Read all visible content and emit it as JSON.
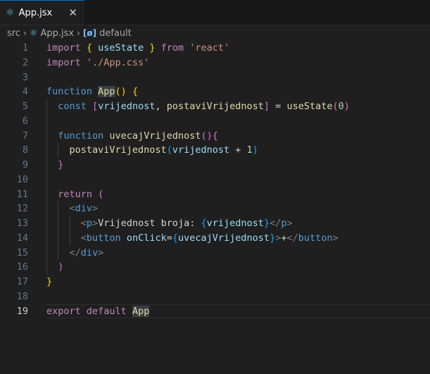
{
  "tab": {
    "label": "App.jsx",
    "close": "✕"
  },
  "breadcrumb": {
    "folder": "src",
    "file": "App.jsx",
    "symbol": "default"
  },
  "editor": {
    "current_line": 19,
    "lines": [
      {
        "n": "1",
        "indent": 0,
        "tokens": [
          {
            "t": "import ",
            "c": "tk-ctrl"
          },
          {
            "t": "{",
            "c": "tk-b1"
          },
          {
            "t": " useState ",
            "c": "tk-var"
          },
          {
            "t": "}",
            "c": "tk-b1"
          },
          {
            "t": " from ",
            "c": "tk-ctrl"
          },
          {
            "t": "'react'",
            "c": "tk-str"
          }
        ]
      },
      {
        "n": "2",
        "indent": 0,
        "tokens": [
          {
            "t": "import ",
            "c": "tk-ctrl"
          },
          {
            "t": "'./App.css'",
            "c": "tk-str"
          }
        ]
      },
      {
        "n": "3",
        "indent": 0,
        "tokens": []
      },
      {
        "n": "4",
        "indent": 0,
        "tokens": [
          {
            "t": "function ",
            "c": "tk-kw"
          },
          {
            "t": "App",
            "c": "tk-fn tk-hl"
          },
          {
            "t": "()",
            "c": "tk-b1"
          },
          {
            "t": " ",
            "c": "tk-plain"
          },
          {
            "t": "{",
            "c": "tk-b1"
          }
        ]
      },
      {
        "n": "5",
        "indent": 1,
        "tokens": [
          {
            "t": "const ",
            "c": "tk-kw"
          },
          {
            "t": "[",
            "c": "tk-b2"
          },
          {
            "t": "vrijednost",
            "c": "tk-var"
          },
          {
            "t": ", ",
            "c": "tk-plain"
          },
          {
            "t": "postaviVrijednost",
            "c": "tk-fn"
          },
          {
            "t": "]",
            "c": "tk-b2"
          },
          {
            "t": " = ",
            "c": "tk-plain"
          },
          {
            "t": "useState",
            "c": "tk-fn"
          },
          {
            "t": "(",
            "c": "tk-b2"
          },
          {
            "t": "0",
            "c": "tk-num"
          },
          {
            "t": ")",
            "c": "tk-b2"
          }
        ]
      },
      {
        "n": "6",
        "indent": 1,
        "tokens": []
      },
      {
        "n": "7",
        "indent": 1,
        "tokens": [
          {
            "t": "function ",
            "c": "tk-kw"
          },
          {
            "t": "uvecajVrijednost",
            "c": "tk-fn"
          },
          {
            "t": "()",
            "c": "tk-b2"
          },
          {
            "t": "{",
            "c": "tk-b2"
          }
        ]
      },
      {
        "n": "8",
        "indent": 2,
        "tokens": [
          {
            "t": "postaviVrijednost",
            "c": "tk-fn"
          },
          {
            "t": "(",
            "c": "tk-b3"
          },
          {
            "t": "vrijednost",
            "c": "tk-var"
          },
          {
            "t": " + ",
            "c": "tk-plain"
          },
          {
            "t": "1",
            "c": "tk-num"
          },
          {
            "t": ")",
            "c": "tk-b3"
          }
        ]
      },
      {
        "n": "9",
        "indent": 1,
        "tokens": [
          {
            "t": "}",
            "c": "tk-b2"
          }
        ]
      },
      {
        "n": "10",
        "indent": 1,
        "tokens": []
      },
      {
        "n": "11",
        "indent": 1,
        "tokens": [
          {
            "t": "return ",
            "c": "tk-ctrl"
          },
          {
            "t": "(",
            "c": "tk-b2"
          }
        ]
      },
      {
        "n": "12",
        "indent": 2,
        "tokens": [
          {
            "t": "<",
            "c": "tk-tagbr"
          },
          {
            "t": "div",
            "c": "tk-tag"
          },
          {
            "t": ">",
            "c": "tk-tagbr"
          }
        ]
      },
      {
        "n": "13",
        "indent": 3,
        "tokens": [
          {
            "t": "<",
            "c": "tk-tagbr"
          },
          {
            "t": "p",
            "c": "tk-tag"
          },
          {
            "t": ">",
            "c": "tk-tagbr"
          },
          {
            "t": "Vrijednost broja: ",
            "c": "tk-plain"
          },
          {
            "t": "{",
            "c": "tk-b3"
          },
          {
            "t": "vrijednost",
            "c": "tk-var"
          },
          {
            "t": "}",
            "c": "tk-b3"
          },
          {
            "t": "</",
            "c": "tk-tagbr"
          },
          {
            "t": "p",
            "c": "tk-tag"
          },
          {
            "t": ">",
            "c": "tk-tagbr"
          }
        ]
      },
      {
        "n": "14",
        "indent": 3,
        "tokens": [
          {
            "t": "<",
            "c": "tk-tagbr"
          },
          {
            "t": "button ",
            "c": "tk-tag"
          },
          {
            "t": "onClick",
            "c": "tk-attr"
          },
          {
            "t": "=",
            "c": "tk-plain"
          },
          {
            "t": "{",
            "c": "tk-b3"
          },
          {
            "t": "uvecajVrijednost",
            "c": "tk-var"
          },
          {
            "t": "}",
            "c": "tk-b3"
          },
          {
            "t": ">",
            "c": "tk-tagbr"
          },
          {
            "t": "+",
            "c": "tk-plain"
          },
          {
            "t": "</",
            "c": "tk-tagbr"
          },
          {
            "t": "button",
            "c": "tk-tag"
          },
          {
            "t": ">",
            "c": "tk-tagbr"
          }
        ]
      },
      {
        "n": "15",
        "indent": 2,
        "tokens": [
          {
            "t": "</",
            "c": "tk-tagbr"
          },
          {
            "t": "div",
            "c": "tk-tag"
          },
          {
            "t": ">",
            "c": "tk-tagbr"
          }
        ]
      },
      {
        "n": "16",
        "indent": 1,
        "tokens": [
          {
            "t": ")",
            "c": "tk-b2"
          }
        ]
      },
      {
        "n": "17",
        "indent": 0,
        "tokens": [
          {
            "t": "}",
            "c": "tk-b1"
          }
        ]
      },
      {
        "n": "18",
        "indent": 0,
        "tokens": []
      },
      {
        "n": "19",
        "indent": 0,
        "tokens": [
          {
            "t": "export ",
            "c": "tk-ctrl"
          },
          {
            "t": "default ",
            "c": "tk-ctrl"
          },
          {
            "t": "App",
            "c": "tk-fn tk-hl"
          }
        ]
      }
    ]
  }
}
